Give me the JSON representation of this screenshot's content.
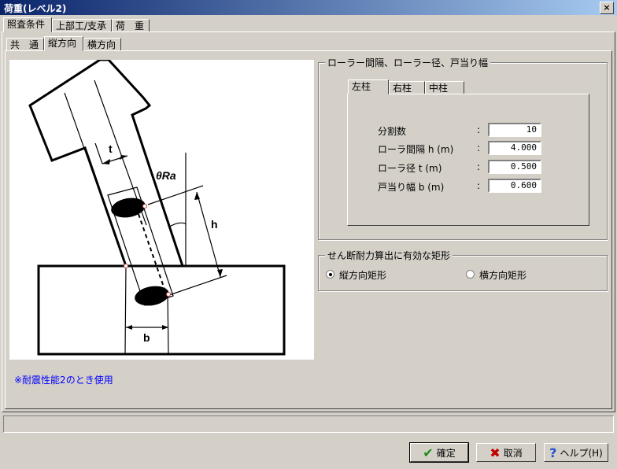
{
  "window": {
    "title": "荷重(レベル2)",
    "close_label": "×"
  },
  "main_tabs": [
    "照査条件",
    "上部工/支承",
    "荷　重"
  ],
  "sub_tabs": [
    "共　通",
    "縦方向",
    "横方向"
  ],
  "diagram": {
    "label_t": "t",
    "label_theta": "θRa",
    "label_h": "h",
    "label_b": "b"
  },
  "note": "※耐震性能2のとき使用",
  "roller_group": {
    "title": "ローラー間隔、ローラー径、戸当り幅",
    "tabs": [
      "左柱",
      "右柱",
      "中柱"
    ],
    "fields": [
      {
        "label": "分割数",
        "value": "10"
      },
      {
        "label": "ローラ間隔 h (m)",
        "value": "4.000"
      },
      {
        "label": "ローラ径 t (m)",
        "value": "0.500"
      },
      {
        "label": "戸当り幅 b (m)",
        "value": "0.600"
      }
    ],
    "colon": ":"
  },
  "shear_group": {
    "title": "せん断耐力算出に有効な矩形",
    "options": [
      {
        "label": "縦方向矩形",
        "selected": true
      },
      {
        "label": "横方向矩形",
        "selected": false
      }
    ]
  },
  "buttons": {
    "ok": "確定",
    "cancel": "取消",
    "help": "ヘルプ(H)"
  },
  "colors": {
    "title_start": "#0a246a",
    "note_text": "#0000ff",
    "ok_check": "#1a8a1a",
    "cancel_x": "#c00000",
    "help_q": "#1e4fd0"
  }
}
